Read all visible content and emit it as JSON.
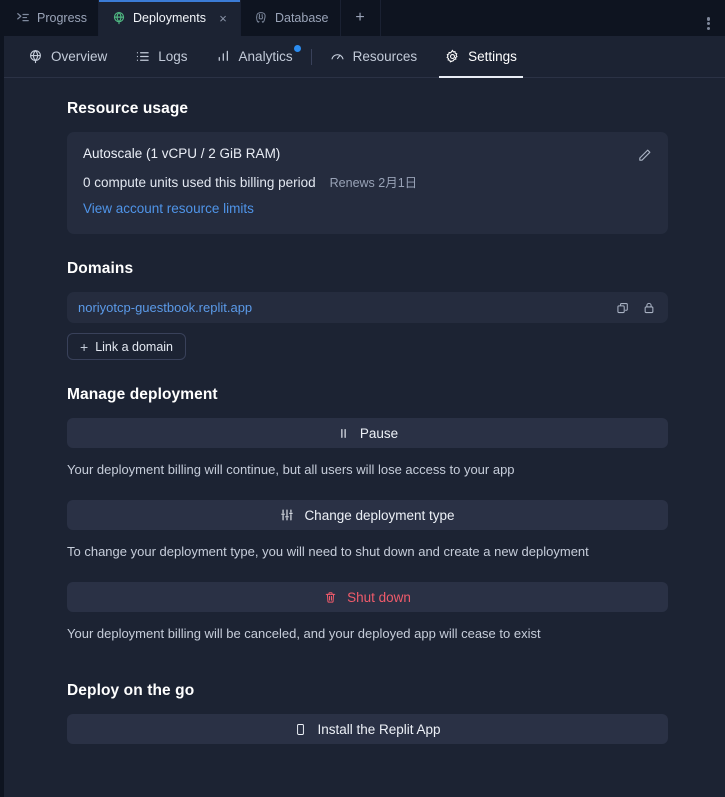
{
  "window": {
    "tabs": [
      {
        "label": "Progress",
        "icon": "progress-icon",
        "active": false,
        "closable": false
      },
      {
        "label": "Deployments",
        "icon": "deployments-globe-icon",
        "active": true,
        "closable": true,
        "close_label": "×"
      },
      {
        "label": "Database",
        "icon": "postgres-elephant-icon",
        "active": false,
        "closable": false
      }
    ],
    "new_tab_label": "+",
    "overflow_menu_label": "more-options"
  },
  "subnav": {
    "items": [
      {
        "label": "Overview",
        "icon": "deployments-globe-icon",
        "active": false,
        "badge": false
      },
      {
        "label": "Logs",
        "icon": "list-icon",
        "active": false,
        "badge": false
      },
      {
        "label": "Analytics",
        "icon": "bar-chart-icon",
        "active": false,
        "badge": true
      },
      {
        "label": "Resources",
        "icon": "gauge-icon",
        "active": false,
        "badge": false
      },
      {
        "label": "Settings",
        "icon": "gear-icon",
        "active": true,
        "badge": false
      }
    ]
  },
  "resource_usage": {
    "title": "Resource usage",
    "plan": "Autoscale (1 vCPU / 2 GiB RAM)",
    "usage": "0 compute units used this billing period",
    "renews": "Renews 2月1日",
    "link": "View account resource limits",
    "edit_label": "edit"
  },
  "domains": {
    "title": "Domains",
    "entries": [
      {
        "name": "noriyotcp-guestbook.replit.app",
        "copy_label": "copy",
        "lock_label": "secure"
      }
    ],
    "link_domain_label": "Link a domain",
    "plus": "+"
  },
  "manage_deployment": {
    "title": "Manage deployment",
    "actions": [
      {
        "label": "Pause",
        "icon": "pause-icon",
        "help": "Your deployment billing will continue, but all users will lose access to your app",
        "danger": false
      },
      {
        "label": "Change deployment type",
        "icon": "sliders-icon",
        "help": "To change your deployment type, you will need to shut down and create a new deployment",
        "danger": false
      },
      {
        "label": "Shut down",
        "icon": "trash-icon",
        "help": "Your deployment billing will be canceled, and your deployed app will cease to exist",
        "danger": true
      }
    ]
  },
  "deploy_on_the_go": {
    "title": "Deploy on the go",
    "install_label": "Install the Replit App",
    "install_icon": "mobile-phone-icon"
  },
  "colors": {
    "app_bg": "#1c2333",
    "chrome_bg": "#0e1420",
    "card_bg": "#252c3e",
    "button_bg": "#2a3145",
    "accent_link": "#4f94e8",
    "accent_tab": "#3b7cd6",
    "danger": "#ef5b6b",
    "badge": "#2b8cf0",
    "deploy_green": "#4fb782"
  }
}
